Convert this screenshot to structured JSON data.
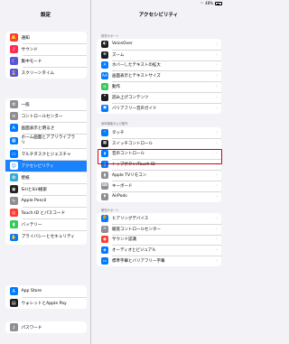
{
  "status": {
    "time": "20:49",
    "battery": "48%"
  },
  "left": {
    "title": "設定",
    "groups": [
      {
        "items": [
          {
            "label": "通知",
            "icon": "bell-icon",
            "color": "#ff3b30",
            "glyph": "🔔"
          },
          {
            "label": "サウンド",
            "icon": "speaker-icon",
            "color": "#ff2d55",
            "glyph": "♪"
          },
          {
            "label": "集中モード",
            "icon": "moon-icon",
            "color": "#5856d6",
            "glyph": "☾"
          },
          {
            "label": "スクリーンタイム",
            "icon": "hourglass-icon",
            "color": "#5856d6",
            "glyph": "⌛"
          }
        ]
      },
      {
        "items": [
          {
            "label": "一般",
            "icon": "gear-icon",
            "color": "#8e8e93",
            "glyph": "⚙"
          },
          {
            "label": "コントロールセンター",
            "icon": "switches-icon",
            "color": "#8e8e93",
            "glyph": "≡"
          },
          {
            "label": "画面表示と明るさ",
            "icon": "text-size-icon",
            "color": "#007aff",
            "glyph": "A"
          },
          {
            "label": "ホーム画面とアプリライブラリ",
            "icon": "home-grid-icon",
            "color": "#007aff",
            "glyph": "▦",
            "tall": true
          },
          {
            "label": "マルチタスクとジェスチャ",
            "icon": "multitask-icon",
            "color": "#007aff",
            "glyph": "▭"
          },
          {
            "label": "アクセシビリティ",
            "icon": "accessibility-icon",
            "color": "#007aff",
            "glyph": "☺",
            "selected": true
          },
          {
            "label": "壁紙",
            "icon": "wallpaper-icon",
            "color": "#34aadc",
            "glyph": "✿"
          },
          {
            "label": "SiriとSiri検索",
            "icon": "siri-icon",
            "color": "#222222",
            "glyph": "◉"
          },
          {
            "label": "Apple Pencil",
            "icon": "pencil-icon",
            "color": "#8e8e93",
            "glyph": "✎"
          },
          {
            "label": "Touch ID とパスコード",
            "icon": "fingerprint-icon",
            "color": "#ff3b30",
            "glyph": "◎"
          },
          {
            "label": "バッテリー",
            "icon": "battery-icon",
            "color": "#34c759",
            "glyph": "▮"
          },
          {
            "label": "プライバシーとセキュリティ",
            "icon": "hand-icon",
            "color": "#007aff",
            "glyph": "✋",
            "tall": true
          }
        ]
      },
      {
        "items": [
          {
            "label": "App Store",
            "icon": "app-store-icon",
            "color": "#007aff",
            "glyph": "A"
          },
          {
            "label": "ウォレットとApple Pay",
            "icon": "wallet-icon",
            "color": "#1c1c1e",
            "glyph": "▤"
          }
        ]
      },
      {
        "items": [
          {
            "label": "パスワード",
            "icon": "key-icon",
            "color": "#8e8e93",
            "glyph": "⚷"
          }
        ]
      }
    ]
  },
  "right": {
    "title": "アクセシビリティ",
    "sections": [
      {
        "header": "視覚サポート",
        "items": [
          {
            "label": "VoiceOver",
            "icon": "voiceover-icon",
            "color": "#1c1c1e",
            "glyph": "◐"
          },
          {
            "label": "ズーム",
            "icon": "zoom-icon",
            "color": "#1c1c1e",
            "glyph": "⊕"
          },
          {
            "label": "ホバーしたテキストの拡大",
            "icon": "hover-text-icon",
            "color": "#007aff",
            "glyph": "A"
          },
          {
            "label": "画面表示とテキストサイズ",
            "icon": "text-size-icon",
            "color": "#007aff",
            "glyph": "AA"
          },
          {
            "label": "動作",
            "icon": "motion-icon",
            "color": "#34c759",
            "glyph": "◎"
          },
          {
            "label": "読み上げコンテンツ",
            "icon": "speech-icon",
            "color": "#1c1c1e",
            "glyph": "❝"
          },
          {
            "label": "バリアフリー音声ガイド",
            "icon": "audio-description-icon",
            "color": "#007aff",
            "glyph": "▣"
          }
        ]
      },
      {
        "header": "身体機能および動作",
        "items": [
          {
            "label": "タッチ",
            "icon": "touch-icon",
            "color": "#007aff",
            "glyph": "☝"
          },
          {
            "label": "スイッチコントロール",
            "icon": "switch-control-icon",
            "color": "#1c1c1e",
            "glyph": "▦"
          },
          {
            "label": "音声コントロール",
            "icon": "voice-control-icon",
            "color": "#007aff",
            "glyph": "◖"
          },
          {
            "label": "トップボタン/Touch ID",
            "icon": "top-button-icon",
            "color": "#007aff",
            "glyph": "▯"
          },
          {
            "label": "Apple TVリモコン",
            "icon": "tv-remote-icon",
            "color": "#8e8e93",
            "glyph": "▮"
          },
          {
            "label": "キーボード",
            "icon": "keyboard-icon",
            "color": "#8e8e93",
            "glyph": "⌨"
          },
          {
            "label": "AirPods",
            "icon": "airpods-icon",
            "color": "#8e8e93",
            "glyph": "◗"
          }
        ]
      },
      {
        "header": "聴覚サポート",
        "items": [
          {
            "label": "ヒアリングデバイス",
            "icon": "ear-icon",
            "color": "#007aff",
            "glyph": "👂"
          },
          {
            "label": "聴覚コントロールセンター",
            "icon": "hearing-control-icon",
            "color": "#8e8e93",
            "glyph": "≡"
          },
          {
            "label": "サウンド認識",
            "icon": "sound-recognition-icon",
            "color": "#ff3b30",
            "glyph": "◉"
          },
          {
            "label": "オーディオとビジュアル",
            "icon": "av-icon",
            "color": "#007aff",
            "glyph": "◈"
          },
          {
            "label": "標準字幕とバリアフリー字幕",
            "icon": "subtitles-icon",
            "color": "#007aff",
            "glyph": "▭"
          }
        ]
      }
    ]
  }
}
